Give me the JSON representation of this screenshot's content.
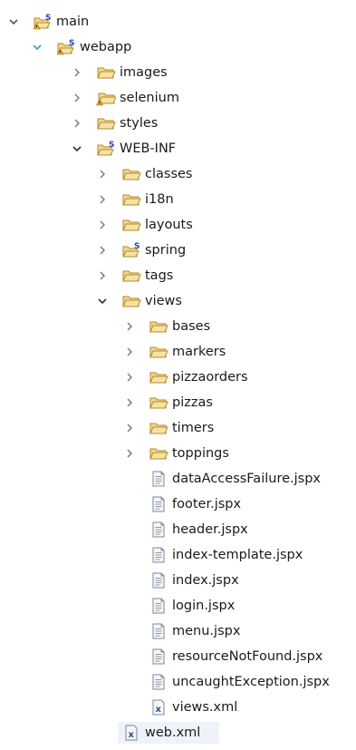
{
  "tree": [
    {
      "label": "main",
      "depth": 0,
      "expanded": true,
      "icon": "spring-folder-warning-icon",
      "leaf": false,
      "twisty_color": "#555555"
    },
    {
      "label": "webapp",
      "depth": 1,
      "expanded": true,
      "icon": "spring-folder-warning-icon",
      "leaf": false,
      "twisty_color": "#2f9fd6"
    },
    {
      "label": "images",
      "depth": 2,
      "expanded": false,
      "icon": "folder-icon",
      "leaf": false
    },
    {
      "label": "selenium",
      "depth": 2,
      "expanded": false,
      "icon": "folder-warning-icon",
      "leaf": false
    },
    {
      "label": "styles",
      "depth": 2,
      "expanded": false,
      "icon": "folder-icon",
      "leaf": false
    },
    {
      "label": "WEB-INF",
      "depth": 2,
      "expanded": true,
      "icon": "spring-folder-icon",
      "leaf": false
    },
    {
      "label": "classes",
      "depth": 3,
      "expanded": false,
      "icon": "folder-icon",
      "leaf": false
    },
    {
      "label": "i18n",
      "depth": 3,
      "expanded": false,
      "icon": "folder-icon",
      "leaf": false
    },
    {
      "label": "layouts",
      "depth": 3,
      "expanded": false,
      "icon": "folder-icon",
      "leaf": false
    },
    {
      "label": "spring",
      "depth": 3,
      "expanded": false,
      "icon": "spring-folder-icon",
      "leaf": false
    },
    {
      "label": "tags",
      "depth": 3,
      "expanded": false,
      "icon": "folder-icon",
      "leaf": false
    },
    {
      "label": "views",
      "depth": 3,
      "expanded": true,
      "icon": "folder-icon",
      "leaf": false
    },
    {
      "label": "bases",
      "depth": 4,
      "expanded": false,
      "icon": "folder-icon",
      "leaf": false
    },
    {
      "label": "markers",
      "depth": 4,
      "expanded": false,
      "icon": "folder-icon",
      "leaf": false
    },
    {
      "label": "pizzaorders",
      "depth": 4,
      "expanded": false,
      "icon": "folder-icon",
      "leaf": false
    },
    {
      "label": "pizzas",
      "depth": 4,
      "expanded": false,
      "icon": "folder-icon",
      "leaf": false
    },
    {
      "label": "timers",
      "depth": 4,
      "expanded": false,
      "icon": "folder-icon",
      "leaf": false
    },
    {
      "label": "toppings",
      "depth": 4,
      "expanded": false,
      "icon": "folder-icon",
      "leaf": false
    },
    {
      "label": "dataAccessFailure.jspx",
      "depth": 4,
      "icon": "jspx-file-icon",
      "leaf": true
    },
    {
      "label": "footer.jspx",
      "depth": 4,
      "icon": "jspx-file-icon",
      "leaf": true
    },
    {
      "label": "header.jspx",
      "depth": 4,
      "icon": "jspx-file-icon",
      "leaf": true
    },
    {
      "label": "index-template.jspx",
      "depth": 4,
      "icon": "jspx-file-icon",
      "leaf": true
    },
    {
      "label": "index.jspx",
      "depth": 4,
      "icon": "jspx-file-icon",
      "leaf": true
    },
    {
      "label": "login.jspx",
      "depth": 4,
      "icon": "jspx-file-icon",
      "leaf": true
    },
    {
      "label": "menu.jspx",
      "depth": 4,
      "icon": "jspx-file-icon",
      "leaf": true
    },
    {
      "label": "resourceNotFound.jspx",
      "depth": 4,
      "icon": "jspx-file-icon",
      "leaf": true
    },
    {
      "label": "uncaughtException.jspx",
      "depth": 4,
      "icon": "jspx-file-icon",
      "leaf": true
    },
    {
      "label": "views.xml",
      "depth": 4,
      "icon": "xml-file-icon",
      "leaf": true
    },
    {
      "label": "web.xml",
      "depth": 3,
      "icon": "xml-file-icon",
      "leaf": true,
      "selected": true
    }
  ],
  "colors": {
    "folder_fill": "#f3d68a",
    "folder_stroke": "#b58b2a",
    "spring_badge": "#2b3fb8",
    "warning": "#e0a526",
    "xml_badge": "#2a4a9a",
    "selection_bg": "#eef3fb"
  }
}
